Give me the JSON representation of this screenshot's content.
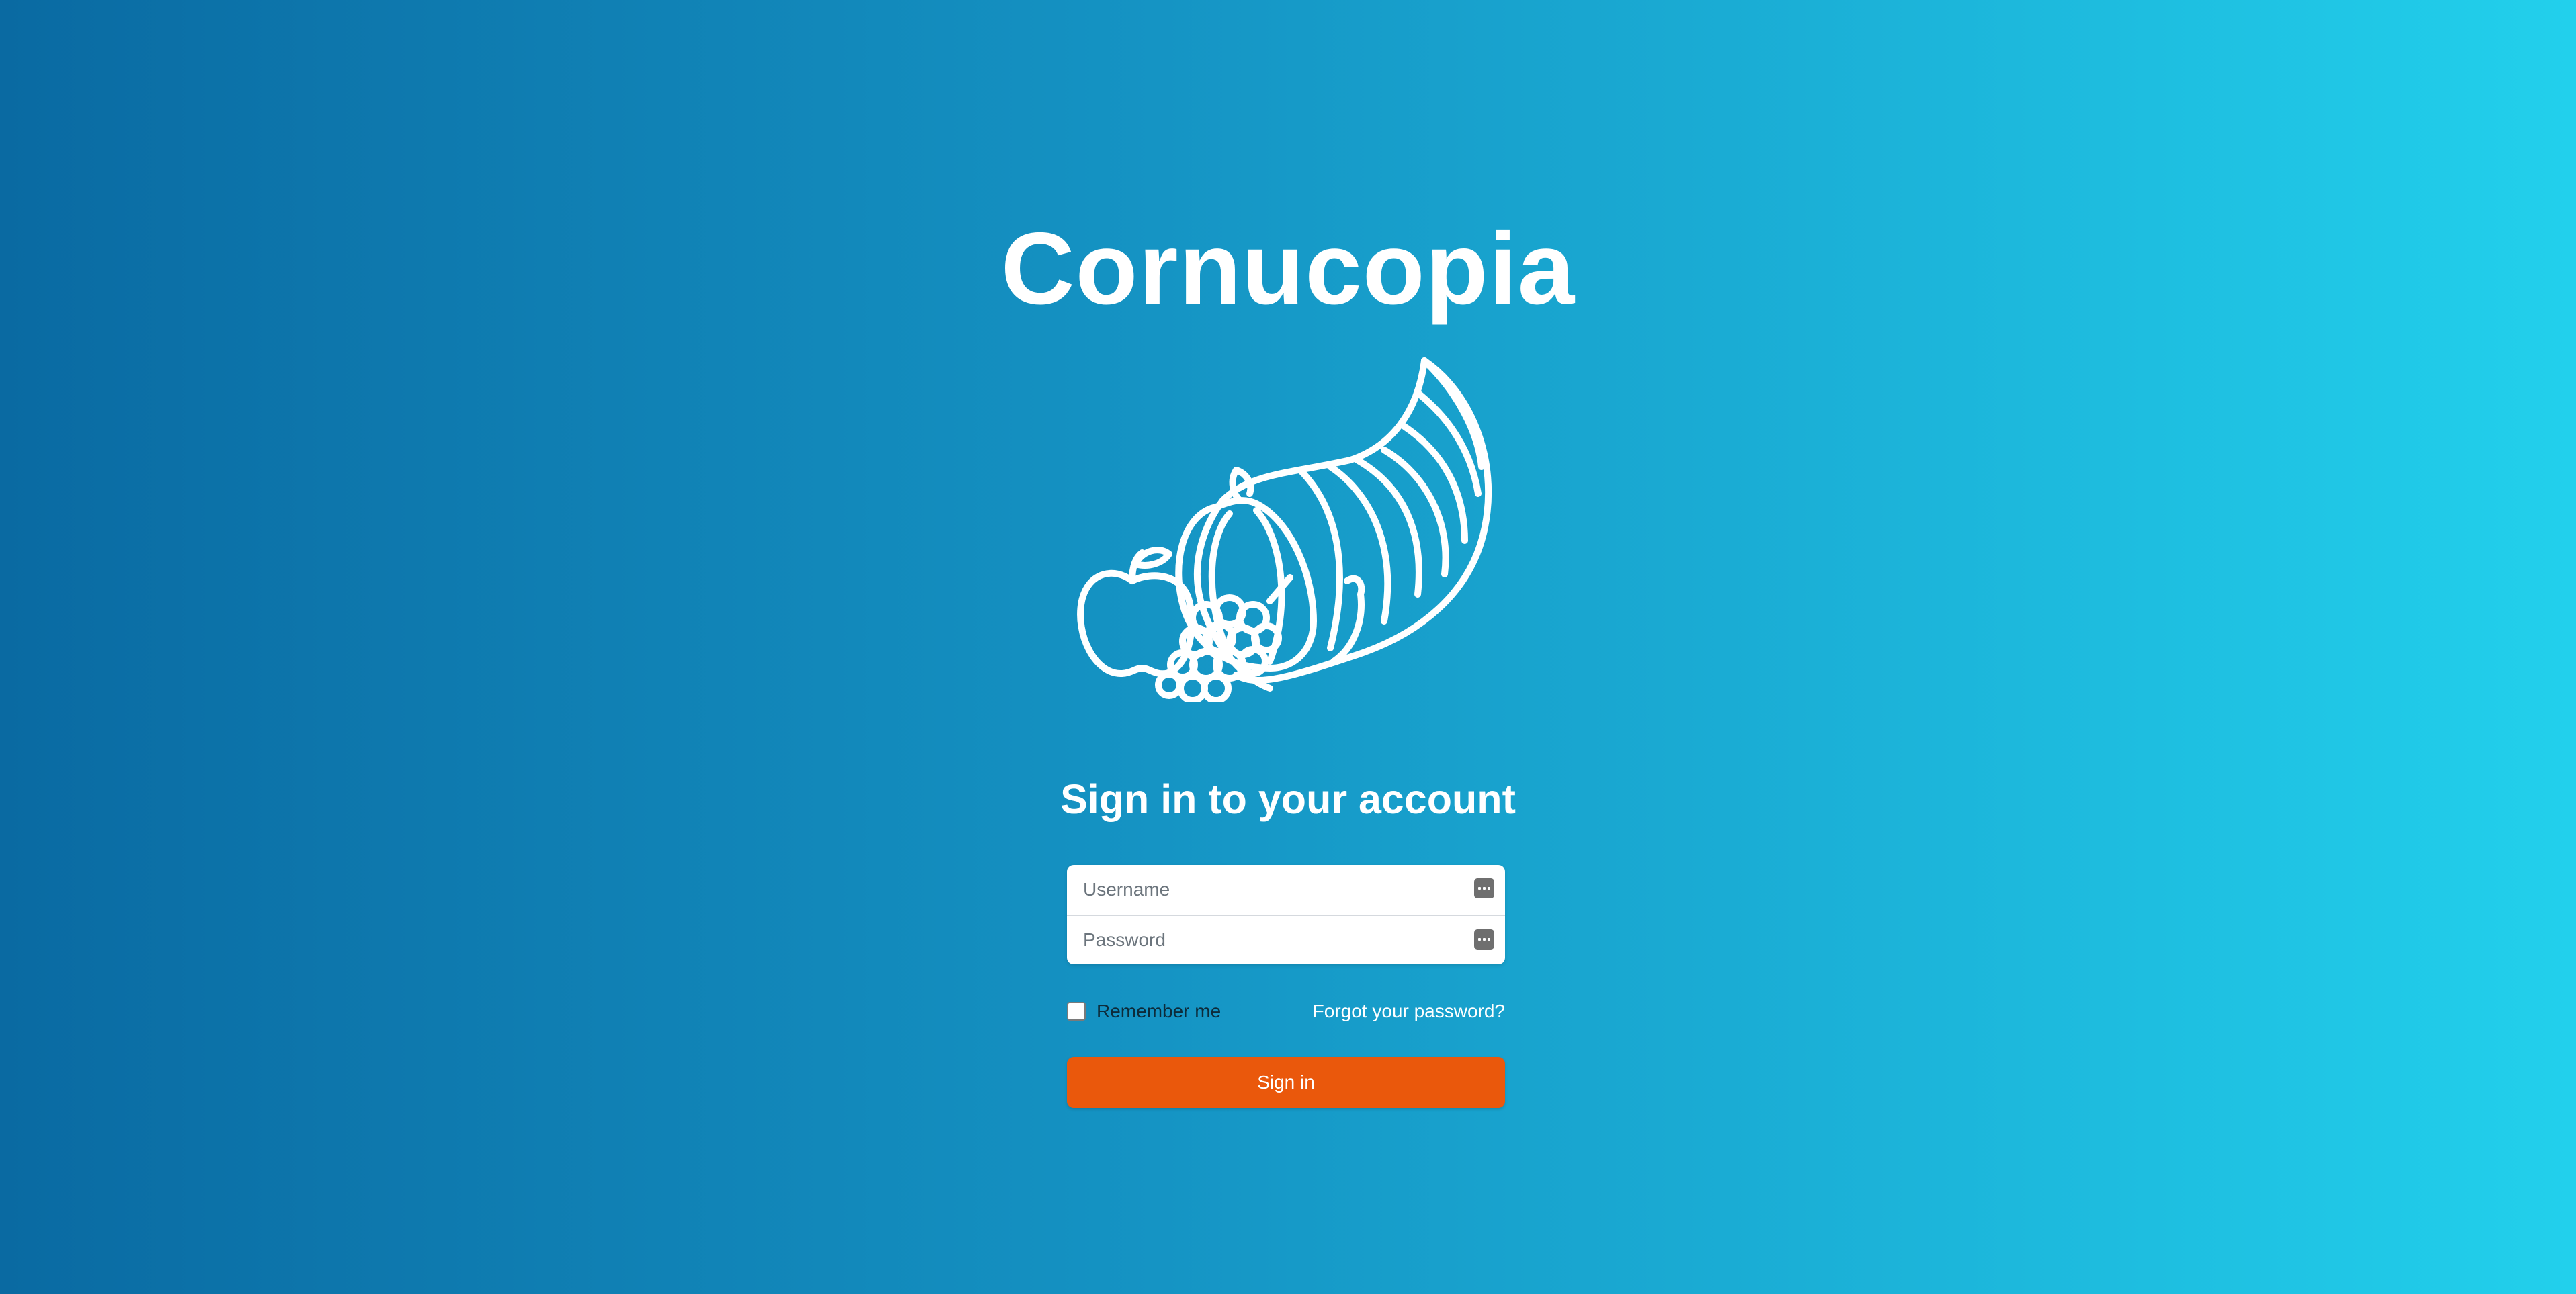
{
  "app": {
    "title": "Cornucopia",
    "logo_icon": "cornucopia-icon"
  },
  "form": {
    "heading": "Sign in to your account",
    "username": {
      "value": "",
      "placeholder": "Username",
      "icon": "keyboard-icon"
    },
    "password": {
      "value": "",
      "placeholder": "Password",
      "icon": "keyboard-icon"
    },
    "remember_label": "Remember me",
    "remember_checked": false,
    "forgot_label": "Forgot your password?",
    "submit_label": "Sign in"
  },
  "colors": {
    "background_start": "#0a6aa2",
    "background_end": "#22d0ec",
    "button": "#ea580c",
    "text": "#ffffff"
  }
}
